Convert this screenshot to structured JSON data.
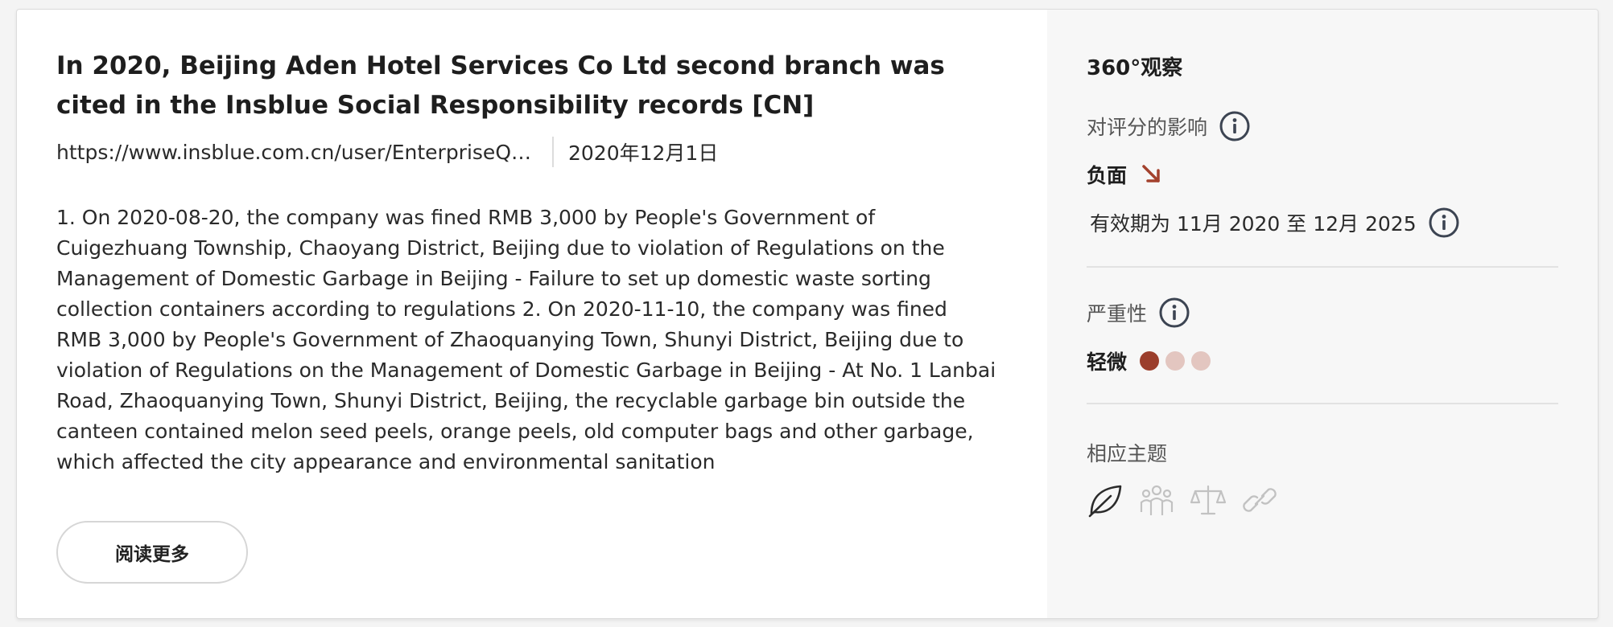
{
  "article": {
    "title": "In 2020, Beijing Aden Hotel Services Co Ltd second branch was cited in the Insblue Social Responsibility records [CN]",
    "url": "https://www.insblue.com.cn/user/EnterpriseQu...",
    "date": "2020年12月1日",
    "body": "1. On 2020-08-20, the company was fined RMB 3,000 by People's Government of Cuigezhuang Township, Chaoyang District, Beijing due to violation of Regulations on the Management of Domestic Garbage in Beijing - Failure to set up domestic waste sorting collection containers according to regulations 2. On 2020-11-10, the company was fined RMB 3,000 by People's Government of Zhaoquanying Town, Shunyi District, Beijing due to violation of Regulations on the Management of Domestic Garbage in Beijing - At No. 1 Lanbai Road, Zhaoquanying Town, Shunyi District, Beijing, the recyclable garbage bin outside the canteen contained melon seed peels, orange peels, old computer bags and other garbage, which affected the city appearance and environmental sanitation",
    "read_more_label": "阅读更多"
  },
  "sidebar": {
    "heading": "360°观察",
    "impact": {
      "label": "对评分的影响",
      "value": "负面",
      "icon": "arrow-down-right-icon",
      "color": "#a3412d"
    },
    "validity": "有效期为 11月 2020 至 12月 2025",
    "severity": {
      "label": "严重性",
      "value": "轻微",
      "level": 1,
      "max": 3,
      "active_color": "#9b3e2c",
      "inactive_color": "#e3c6c0"
    },
    "topics": {
      "label": "相应主题",
      "items": [
        {
          "icon": "leaf-icon",
          "active": true
        },
        {
          "icon": "people-icon",
          "active": false
        },
        {
          "icon": "scales-icon",
          "active": false
        },
        {
          "icon": "link-icon",
          "active": false
        }
      ]
    }
  }
}
